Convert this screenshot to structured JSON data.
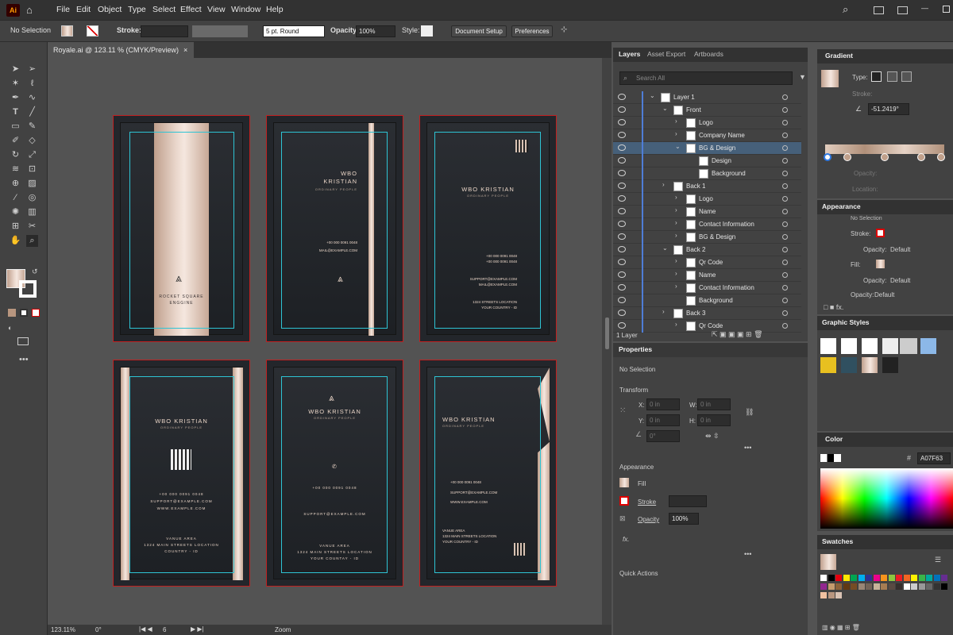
{
  "menubar": {
    "app_logo": "Ai",
    "items": [
      "File",
      "Edit",
      "Object",
      "Type",
      "Select",
      "Effect",
      "View",
      "Window",
      "Help"
    ]
  },
  "control_bar": {
    "selection": "No Selection",
    "stroke_label": "Stroke:",
    "brush": "5 pt. Round",
    "opacity_label": "Opacity:",
    "opacity_value": "100%",
    "style_label": "Style:",
    "doc_setup": "Document Setup",
    "preferences": "Preferences"
  },
  "document_tab": {
    "title": "Royale.ai @ 123.11 % (CMYK/Preview)",
    "close": "×"
  },
  "cards": {
    "c1": {
      "brand1": "ROCKET SQUARE",
      "brand2": "ENGGINE"
    },
    "c2": {
      "name1": "WBO",
      "name2": "KRISTIAN",
      "sub": "ORDINARY PEOPLE",
      "phone": "+00 000 0091 0048",
      "mail": "MAIL@EXAMPLE.COM"
    },
    "c3": {
      "name": "WBO KRISTIAN",
      "sub": "ORDINARY PEOPLE",
      "phone1": "+00 000 0091 0048",
      "phone2": "+00 000 0091 0048",
      "mail1": "SUPPORT@EXAMPLE.COM",
      "mail2": "MAIL@EXAMPLE.COM",
      "addr1": "1324 STREETS LOCATION",
      "addr2": "YOUR COUNTRY - ID"
    },
    "c4": {
      "name": "WBO KRISTIAN",
      "sub": "ORDINARY PEOPLE",
      "phone": "+00 000 0091 0048",
      "mail": "SUPPORT@EXAMPLE.COM",
      "web": "WWW.EXAMPLE.COM",
      "venue": "VANUE AREA",
      "addr1": "1324 MAIN STREETS LOCATION",
      "addr2": "COUNTRY - ID"
    },
    "c5": {
      "name": "WBO KRISTIAN",
      "sub": "ORDINARY PEOPLE",
      "phone": "+00 000 0091 0048",
      "mail": "SUPPORT@EXAMPLE.COM",
      "venue": "VANUE AREA",
      "addr1": "1324 MAIN STREETS LOCATION",
      "addr2": "YOUR COUNTAY - ID"
    },
    "c6": {
      "name": "WBO KRISTIAN",
      "sub": "ORDINARY PEOPLE",
      "phone": "+00 000 0091 0048",
      "mail": "SUPPORT@EXAMPLE.COM",
      "web": "WWW.EXAMPLE.COM",
      "venue": "VANUE AREA",
      "addr1": "1324 MAIN STREETS LOCATION",
      "addr2": "YOUR COUNTRY - ID"
    }
  },
  "status": {
    "zoom": "123.11%",
    "rotation": "0°",
    "artboard": "6",
    "mode": "Zoom"
  },
  "layers_panel": {
    "tabs": [
      "Layers",
      "Asset Export",
      "Artboards"
    ],
    "search_placeholder": "Search All",
    "footer": "1 Layer",
    "rows": [
      {
        "label": "Layer 1"
      },
      {
        "label": "Front"
      },
      {
        "label": "Logo"
      },
      {
        "label": "Company Name"
      },
      {
        "label": "BG & Design"
      },
      {
        "label": "Design"
      },
      {
        "label": "Background"
      },
      {
        "label": "Back 1"
      },
      {
        "label": "Logo"
      },
      {
        "label": "Name"
      },
      {
        "label": "Contact Information"
      },
      {
        "label": "BG & Design"
      },
      {
        "label": "Back 2"
      },
      {
        "label": "Qr Code"
      },
      {
        "label": "Name"
      },
      {
        "label": "Contact Information"
      },
      {
        "label": "Background"
      },
      {
        "label": "Back 3"
      },
      {
        "label": "Qr Code"
      }
    ]
  },
  "properties_panel": {
    "title": "Properties",
    "no_selection": "No Selection",
    "transform": "Transform",
    "x": "X:",
    "y": "Y:",
    "w": "W:",
    "h": "H:",
    "x_val": "0 in",
    "y_val": "0 in",
    "w_val": "0 in",
    "h_val": "0 in",
    "angle": "0°",
    "appearance": "Appearance",
    "fill": "Fill",
    "stroke": "Stroke",
    "opacity": "Opacity",
    "opacity_val": "100%",
    "fx": "fx.",
    "quick_actions": "Quick Actions"
  },
  "gradient_panel": {
    "title": "Gradient",
    "type_label": "Type:",
    "stroke_label": "Stroke:",
    "angle": "-51.2419°",
    "opacity_label": "Opacity:",
    "location_label": "Location:"
  },
  "appearance_panel": {
    "title": "Appearance",
    "no_selection": "No Selection",
    "stroke": "Stroke:",
    "fill": "Fill:",
    "opacity": "Opacity:",
    "default": "Default"
  },
  "graphic_styles": {
    "title": "Graphic Styles"
  },
  "color_panel": {
    "title": "Color",
    "hex": "A07F63"
  },
  "swatches": {
    "title": "Swatches"
  }
}
